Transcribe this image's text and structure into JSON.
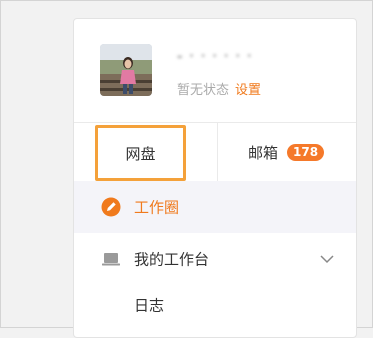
{
  "profile": {
    "username": "- · · · · · ·",
    "status": "暂无状态",
    "settings_label": "设置"
  },
  "tabs": {
    "pan_label": "网盘",
    "mail_label": "邮箱",
    "mail_count": "178"
  },
  "menu": {
    "items": [
      {
        "label": "工作圈",
        "icon": "pencil-circle-icon",
        "active": true
      },
      {
        "label": "我的工作台",
        "icon": "laptop-icon",
        "expand_icon": "chevron-down-icon"
      }
    ],
    "sub_items": [
      {
        "label": "日志"
      }
    ]
  },
  "colors": {
    "accent": "#f07a1d",
    "badge": "#f5792a",
    "highlight_border": "#f4a13a",
    "active_bg": "#f4f4f9",
    "muted_text": "#aaaaaa"
  }
}
